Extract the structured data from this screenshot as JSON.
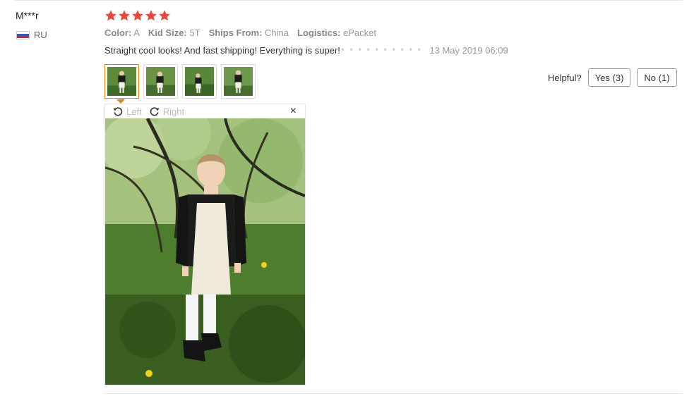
{
  "reviewer": {
    "name": "M***r",
    "country_code": "RU",
    "flag": "russia-flag"
  },
  "rating": {
    "stars": 5,
    "max": 5,
    "color": "#e8473b"
  },
  "attributes": [
    {
      "key": "Color:",
      "value": "A"
    },
    {
      "key": "Kid Size:",
      "value": "5T"
    },
    {
      "key": "Ships From:",
      "value": "China"
    },
    {
      "key": "Logistics:",
      "value": "ePacket"
    }
  ],
  "feedback": {
    "text": "Straight cool looks! And fast shipping! Everything is super!",
    "masked": "* * * * * * * * * *",
    "date": "13 May 2019 06:09"
  },
  "photos": {
    "count": 4,
    "selected_index": 0
  },
  "helpful": {
    "label": "Helpful?",
    "yes_label": "Yes (3)",
    "no_label": "No (1)"
  },
  "viewer": {
    "rotate_left_label": "Left",
    "rotate_right_label": "Right",
    "close_glyph": "×"
  },
  "colors": {
    "accent": "#f08200",
    "muted": "#999999"
  }
}
